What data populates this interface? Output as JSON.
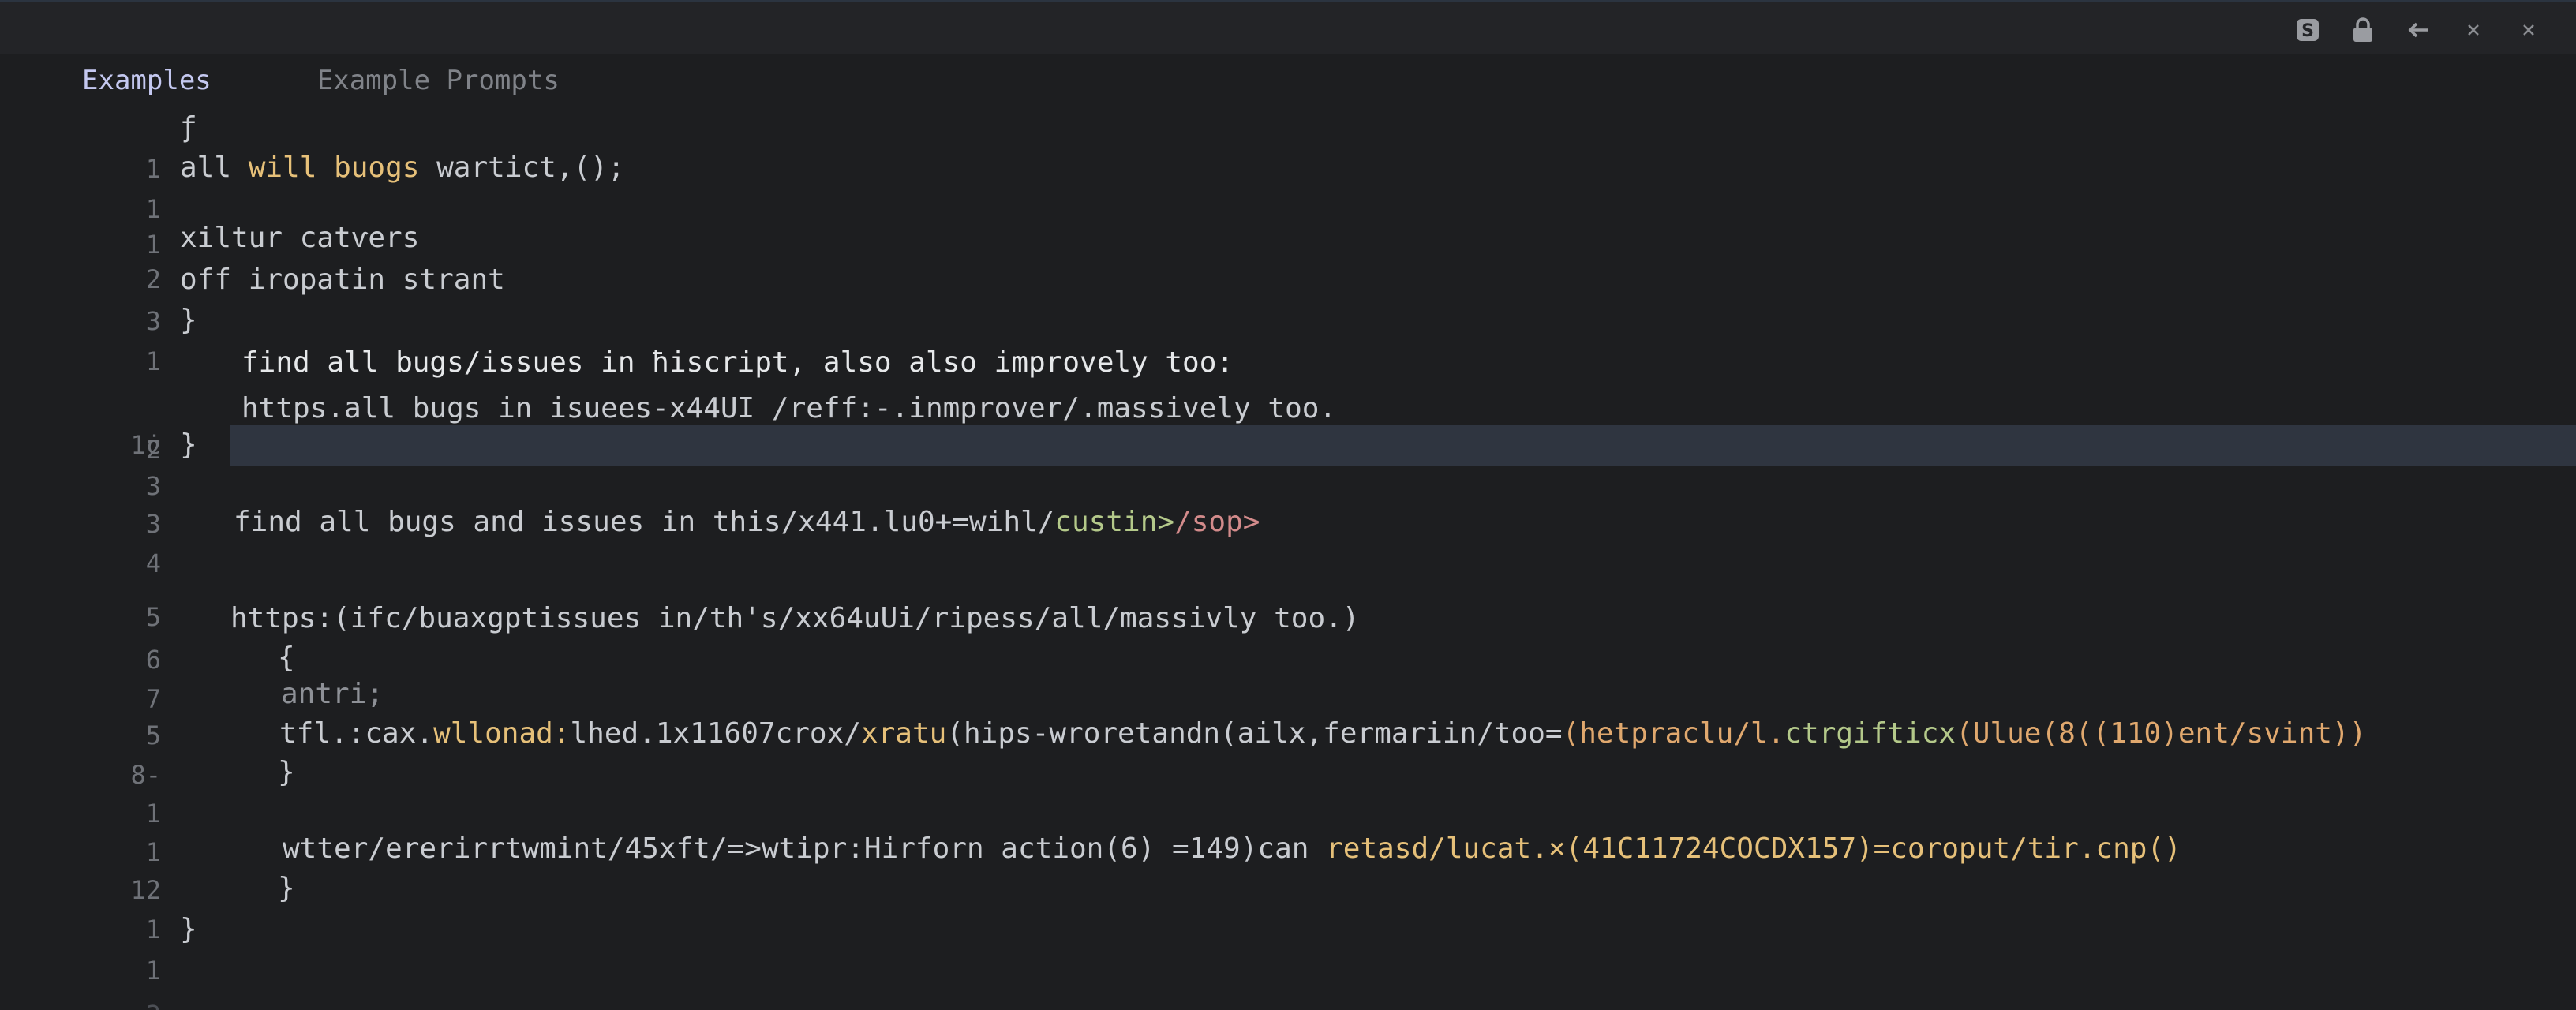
{
  "tabs": {
    "active": "Examples",
    "inactive": "Example Prompts"
  },
  "window_controls": [
    "copy-icon",
    "lock-icon",
    "back-arrow-icon",
    "minimize-x-icon",
    "close-icon"
  ],
  "lines": [
    {
      "n": "1",
      "parts": [
        "ƒ"
      ]
    },
    {
      "n": "1",
      "parts": [
        "all ",
        "will buogs",
        " wartict,();"
      ]
    },
    {
      "n": "1",
      "parts": [
        ""
      ]
    },
    {
      "n": "2",
      "parts": [
        "xiltur catѵers"
      ]
    },
    {
      "n": "3",
      "parts": [
        "οff iropatin strant"
      ]
    },
    {
      "n": "1",
      "parts": [
        "}"
      ]
    },
    {
      "n": "1ċ",
      "parts": [
        "find all bugs/issues in ħiscript, also also improvely too:"
      ]
    },
    {
      "n": "2",
      "parts": [
        "https.all bugs in isuees-x44UI /reff:-.inmprover/.massively too."
      ]
    },
    {
      "n": "3",
      "parts": [
        "}"
      ]
    },
    {
      "n": "3",
      "parts": [
        ""
      ]
    },
    {
      "n": "4",
      "parts": [
        "find all bugs and issues in this/x441.lu0+=wihl/",
        "custin>",
        "/sop>"
      ]
    },
    {
      "n": "5",
      "parts": [
        ""
      ]
    },
    {
      "n": "6",
      "parts": [
        "https:(ifc/buaxgptissues in/th's/xx64uUi/ripess/all/massivly too.)"
      ]
    },
    {
      "n": "7",
      "parts": [
        "{"
      ]
    },
    {
      "n": "5",
      "parts": [
        "antri;"
      ]
    },
    {
      "n": "8-",
      "parts": [
        "tfl.:cax.",
        "wllonad:",
        "lhed.1x11607crox/",
        "xratu",
        "(hips-wroretandn(ailx,fermariin/too=",
        "(hetpraclu/l.",
        "ctrgifticx",
        "(Ulue(8((110)ent/svint))"
      ]
    },
    {
      "n": "1",
      "parts": [
        "}"
      ]
    },
    {
      "n": "1",
      "parts": [
        ""
      ]
    },
    {
      "n": "12",
      "parts": [
        "wtter/ererirrtwmint/45xft/=>wtipr:Hirforn action(6) =149)can ",
        "retasd/lucat.×(41C11724COCDX157)=coroput/tir.cnp()"
      ]
    },
    {
      "n": "1",
      "parts": [
        "}"
      ]
    },
    {
      "n": "1",
      "parts": [
        "}"
      ]
    },
    {
      "n": "3",
      "parts": [
        ""
      ]
    }
  ]
}
